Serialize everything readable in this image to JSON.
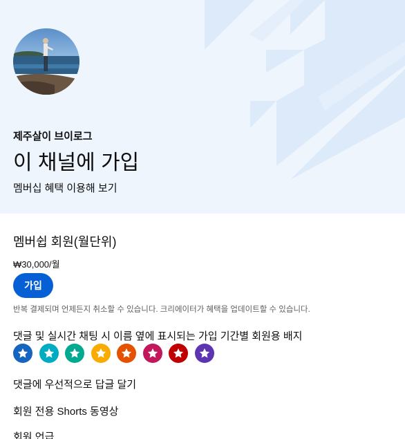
{
  "header": {
    "channel_name": "제주살이 브이로그",
    "title": "이 채널에 가입",
    "subtitle": "멤버십 혜택 이용해 보기"
  },
  "tier": {
    "name": "멤버쉽 회원(월단위)",
    "price": "₩30,000/월",
    "join_label": "가입",
    "fine_print": "반복 결제되며 언제든지 취소할 수 있습니다. 크리에이터가 혜택을 업데이트할 수 있습니다."
  },
  "perks": {
    "badges_title": "댓글 및 실시간 채팅 시 이름 옆에 표시되는 가입 기간별 회원용 배지",
    "badges": [
      {
        "icon": "star-icon",
        "color": "#1565c0"
      },
      {
        "icon": "star-icon",
        "color": "#00acc1"
      },
      {
        "icon": "star-icon",
        "color": "#00a98f"
      },
      {
        "icon": "star-icon",
        "color": "#f9ab00"
      },
      {
        "icon": "star-icon",
        "color": "#e65100"
      },
      {
        "icon": "star-icon",
        "color": "#c2185b"
      },
      {
        "icon": "star-icon",
        "color": "#c00000"
      },
      {
        "icon": "star-icon",
        "color": "#5e35b1"
      }
    ],
    "items": [
      "댓글에 우선적으로 답글 달기",
      "회원 전용 Shorts 동영상",
      "회원 언급"
    ]
  },
  "colors": {
    "header_bg": "#eef5fd",
    "accent": "#065fd4"
  }
}
